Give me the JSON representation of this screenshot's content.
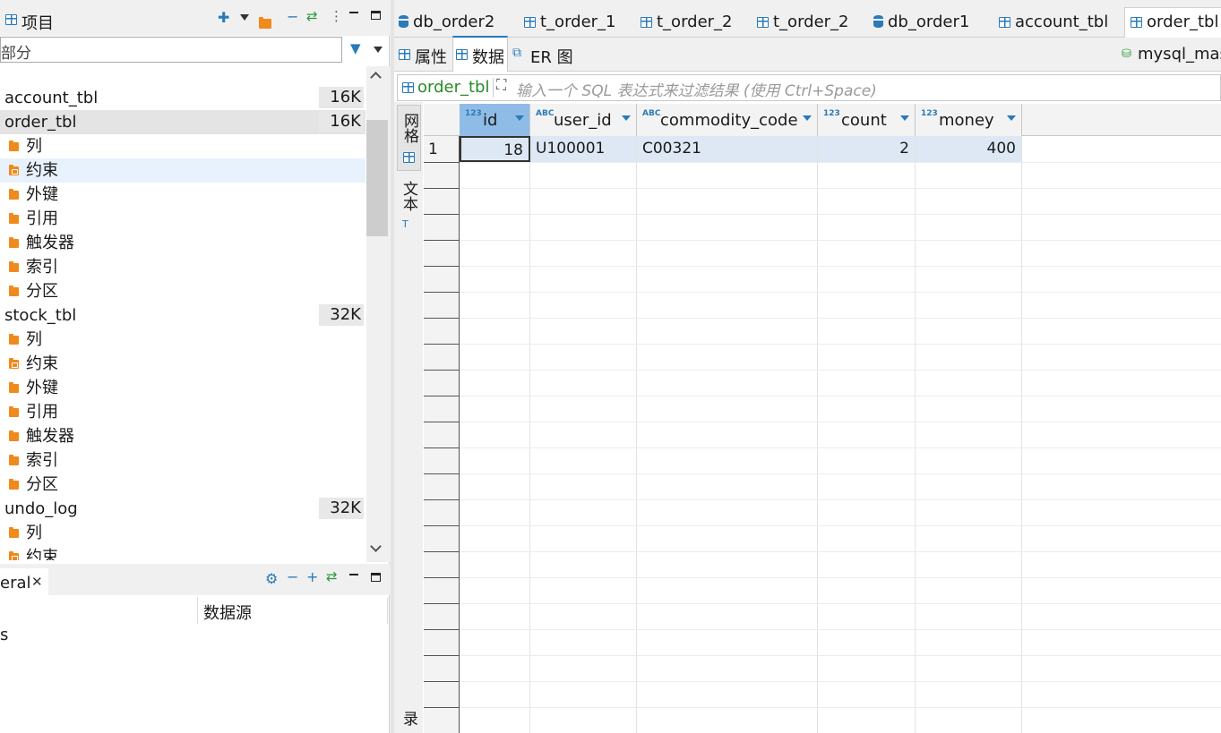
{
  "left_panel": {
    "title": "项目",
    "filter_text": "部分",
    "tree": [
      {
        "label": "account_tbl",
        "size": "16K",
        "level": 0
      },
      {
        "label": "order_tbl",
        "size": "16K",
        "level": 0,
        "selected": true
      },
      {
        "label": "列",
        "level": 1
      },
      {
        "label": "约束",
        "level": 1,
        "icon": "key",
        "hover": true
      },
      {
        "label": "外键",
        "level": 1
      },
      {
        "label": "引用",
        "level": 1
      },
      {
        "label": "触发器",
        "level": 1
      },
      {
        "label": "索引",
        "level": 1
      },
      {
        "label": "分区",
        "level": 1
      },
      {
        "label": "stock_tbl",
        "size": "32K",
        "level": 0
      },
      {
        "label": "列",
        "level": 1
      },
      {
        "label": "约束",
        "level": 1,
        "icon": "key"
      },
      {
        "label": "外键",
        "level": 1
      },
      {
        "label": "引用",
        "level": 1
      },
      {
        "label": "触发器",
        "level": 1
      },
      {
        "label": "索引",
        "level": 1
      },
      {
        "label": "分区",
        "level": 1
      },
      {
        "label": "undo_log",
        "size": "32K",
        "level": 0
      },
      {
        "label": "列",
        "level": 1
      },
      {
        "label": "约束",
        "level": 1,
        "icon": "key"
      }
    ]
  },
  "bottom_panel": {
    "tab_label": "eral",
    "column_header": "数据源",
    "row_text": "s"
  },
  "editor_tabs": [
    {
      "label": "db_order2",
      "icon": "database-icon"
    },
    {
      "label": "t_order_1",
      "icon": "table-icon"
    },
    {
      "label": "t_order_2",
      "icon": "table-icon"
    },
    {
      "label": "t_order_2",
      "icon": "table-icon"
    },
    {
      "label": "db_order1",
      "icon": "database-icon"
    },
    {
      "label": "account_tbl",
      "icon": "table-icon"
    },
    {
      "label": "order_tbl",
      "icon": "table-icon",
      "active": true
    }
  ],
  "sub_tabs": [
    {
      "label": "属性"
    },
    {
      "label": "数据",
      "active": true
    },
    {
      "label": "ER 图"
    }
  ],
  "connection_label": "mysql_mas",
  "filter_bar": {
    "table_name": "order_tbl",
    "placeholder": "输入一个 SQL 表达式来过滤结果 (使用 Ctrl+Space)"
  },
  "side_tabs": {
    "grid": "网格",
    "text": "文本",
    "bottom": "记录"
  },
  "grid": {
    "columns": [
      {
        "name": "id",
        "type": "123"
      },
      {
        "name": "user_id",
        "type": "ABC"
      },
      {
        "name": "commodity_code",
        "type": "ABC"
      },
      {
        "name": "count",
        "type": "123"
      },
      {
        "name": "money",
        "type": "123"
      }
    ],
    "rows": [
      {
        "row_num": "1",
        "cells": [
          "18",
          "U100001",
          "C00321",
          "2",
          "400"
        ]
      }
    ]
  }
}
